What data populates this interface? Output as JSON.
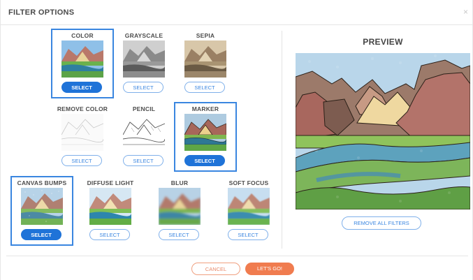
{
  "dialog": {
    "title": "FILTER OPTIONS",
    "close_label": "×"
  },
  "filters": [
    {
      "label": "COLOR",
      "button": "SELECT",
      "selected": true
    },
    {
      "label": "GRAYSCALE",
      "button": "SELECT",
      "selected": false
    },
    {
      "label": "SEPIA",
      "button": "SELECT",
      "selected": false
    },
    {
      "label": "REMOVE COLOR",
      "button": "SELECT",
      "selected": false
    },
    {
      "label": "PENCIL",
      "button": "SELECT",
      "selected": false
    },
    {
      "label": "MARKER",
      "button": "SELECT",
      "selected": true
    },
    {
      "label": "CANVAS BUMPS",
      "button": "SELECT",
      "selected": true
    },
    {
      "label": "DIFFUSE LIGHT",
      "button": "SELECT",
      "selected": false
    },
    {
      "label": "BLUR",
      "button": "SELECT",
      "selected": false
    },
    {
      "label": "SOFT FOCUS",
      "button": "SELECT",
      "selected": false
    }
  ],
  "preview": {
    "title": "PREVIEW",
    "remove_label": "REMOVE ALL FILTERS"
  },
  "footer": {
    "cancel_label": "CANCEL",
    "go_label": "LET'S GO!"
  },
  "colors": {
    "accent_blue": "#1f73d8",
    "accent_orange": "#f07c4f"
  }
}
